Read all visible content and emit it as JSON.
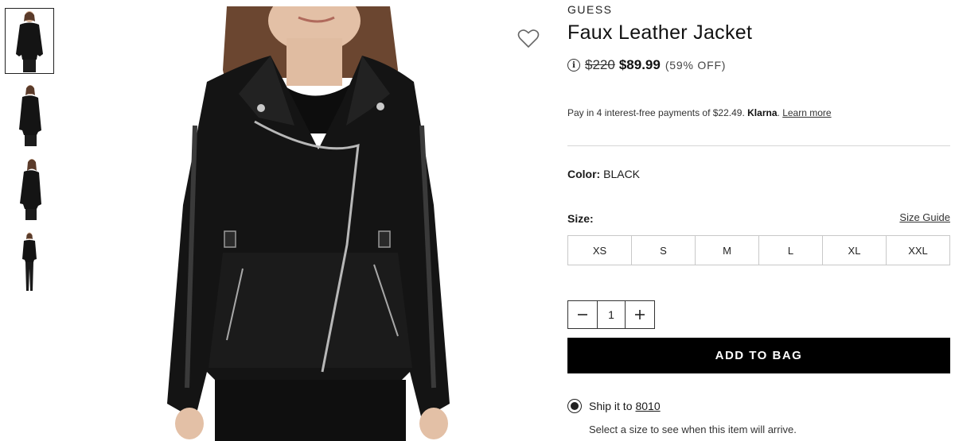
{
  "thumbnails": [
    {
      "name": "thumb-front",
      "active": true
    },
    {
      "name": "thumb-side"
    },
    {
      "name": "thumb-side-alt"
    },
    {
      "name": "thumb-full-body"
    }
  ],
  "product": {
    "brand": "GUESS",
    "title": "Faux Leather Jacket",
    "price_original": "$220",
    "price_sale": "$89.99",
    "discount": "(59% OFF)"
  },
  "klarna": {
    "text": "Pay in 4 interest-free payments of $22.49.",
    "brand": "Klarna",
    "dot": ".",
    "learn_more": "Learn more"
  },
  "color": {
    "label": "Color:",
    "value": "BLACK"
  },
  "size": {
    "label": "Size:",
    "guide": "Size Guide",
    "options": [
      "XS",
      "S",
      "M",
      "L",
      "XL",
      "XXL"
    ]
  },
  "quantity": {
    "value": "1",
    "minus": "−",
    "plus": "+"
  },
  "cta": {
    "add_to_bag": "ADD TO BAG"
  },
  "shipping": {
    "prefix": "Ship it to",
    "zip": "8010",
    "note": "Select a size to see when this item will arrive."
  },
  "icons": {
    "wishlist": "heart-icon",
    "info": "info-icon"
  },
  "colors": {
    "cta_bg": "#000000",
    "text": "#1a1a1a",
    "border": "#c8c8c8"
  }
}
